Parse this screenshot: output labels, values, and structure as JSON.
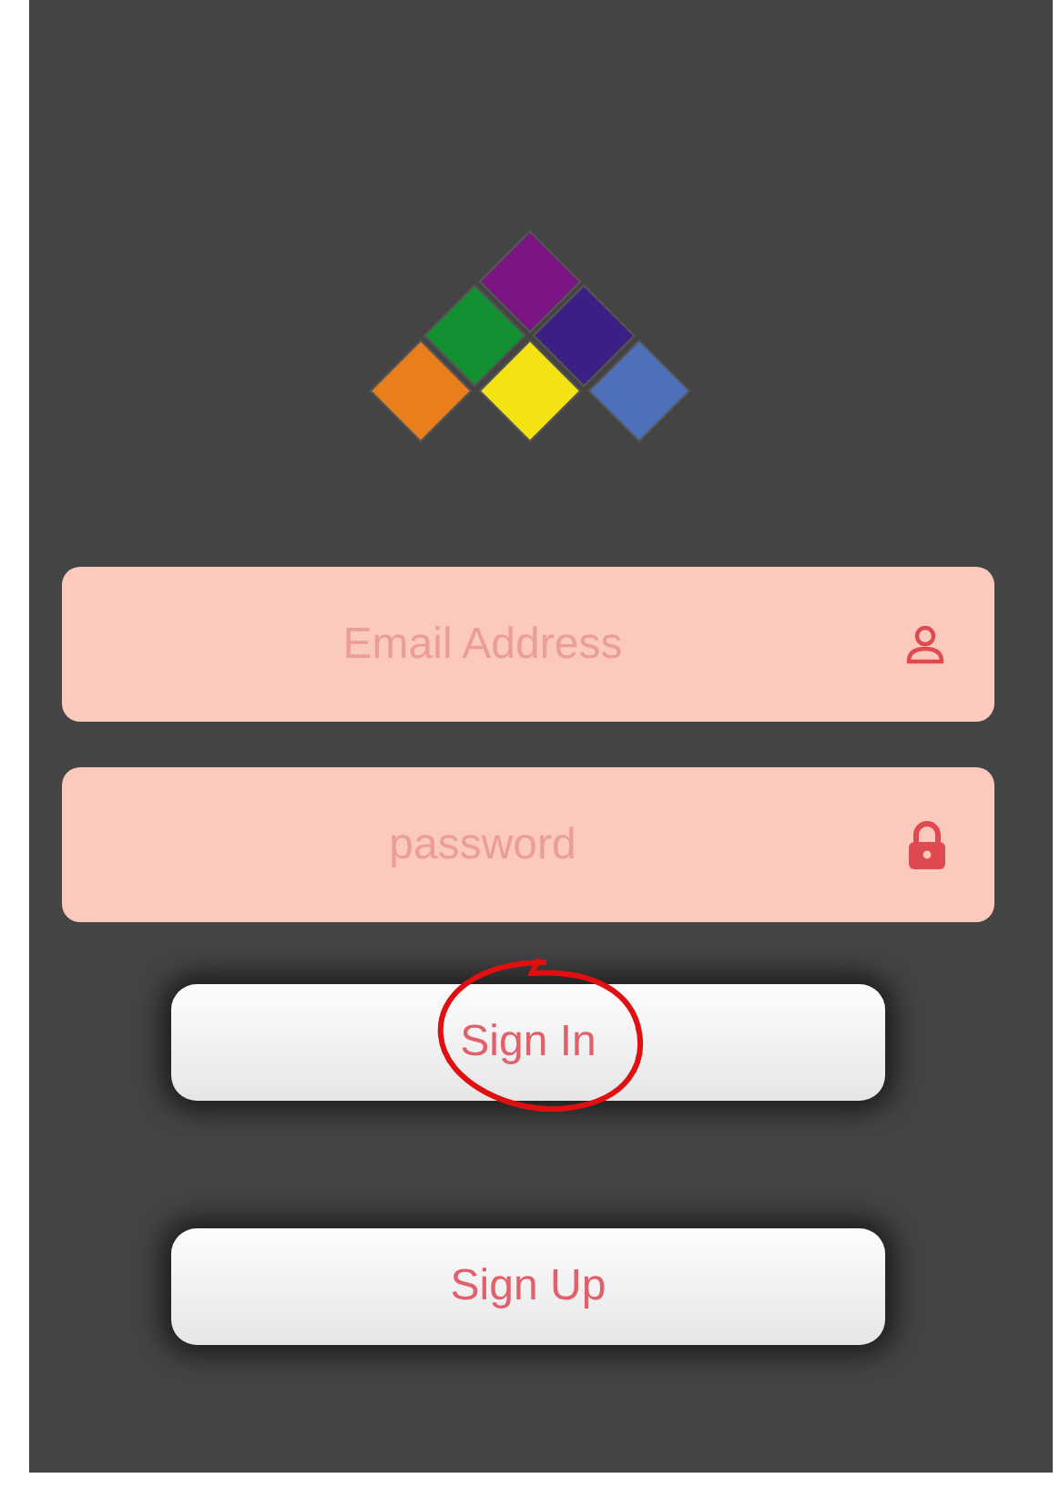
{
  "fields": [
    {
      "kind": "email",
      "placeholder": "Email Address"
    },
    {
      "kind": "password",
      "placeholder": "password"
    }
  ],
  "buttons": [
    {
      "label": "Sign In",
      "circled": true
    },
    {
      "label": "Sign Up",
      "circled": false
    }
  ]
}
